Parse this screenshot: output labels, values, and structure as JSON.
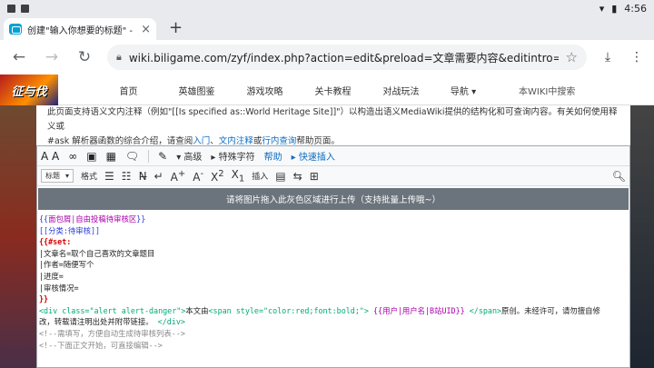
{
  "status": {
    "time": "4:56"
  },
  "browser": {
    "tab_title": "创建\"输入你想要的标题\" - 征",
    "tab_close": "×",
    "new_tab": "+",
    "url": "wiki.biligame.com/zyf/index.php?action=edit&preload=文章需要内容&editintro=创建文章规范&title"
  },
  "site": {
    "logo_text": "征与伐",
    "nav": [
      "首页",
      "英雄图鉴",
      "游戏攻略",
      "关卡教程",
      "对战玩法",
      "导航"
    ],
    "search_link": "本WIKI中搜索"
  },
  "intro": {
    "line1": "此页面支持语义文内注释（例如\"[[Is specified as::World Heritage Site]]\"）以构造出语义MediaWiki提供的结构化和可查询内容。有关如何使用释义或",
    "line2_prefix": "#ask 解析器函数的综合介绍，请查阅",
    "link_intro": "入门",
    "sep1": "、",
    "link_annot": "文内注释",
    "sep2": "或",
    "link_query": "行内查询",
    "line2_suffix": "帮助页面。"
  },
  "editor": {
    "toolbar1": {
      "advanced": "高级",
      "special_chars": "特殊字符",
      "help": "帮助",
      "quick_insert": "快速插入"
    },
    "toolbar2": {
      "heading": "标题",
      "format": "格式",
      "insert": "插入"
    },
    "dropzone": "请将图片拖入此灰色区域进行上传（支持批量上传哦~）",
    "code": {
      "l1_open": "{{",
      "l1_name": "面包屑",
      "l1_arg": "|自由投稿待审核区",
      "l1_close": "}}",
      "l2": "[[分类:待审核]]",
      "l3": "{{#set:",
      "l4": "|文章名=取个自己喜欢的文章题目",
      "l5": "|作者=随便写个",
      "l6": "|进度=",
      "l7": "|审核情况=",
      "l8": "}}",
      "l9_tag": "<div",
      "l9_attr": " class=\"alert alert-danger\">",
      "l9_text": "本文由",
      "l9_span": "<span style=\"color:red;font:bold;\">",
      "l9_tpl": " {{用户|用户名|B站UID}}",
      "l9_spanclose": " </span>",
      "l9_tail": "原创。未经许可，请勿擅自修",
      "l10_text": "改，转载请注明出处并附带链接。",
      "l10_tag": "</div>",
      "l11": "<!--需填写，方便自动生成待审核列表-->",
      "l12": "<!--下面正文开始，可直接编辑-->"
    }
  }
}
